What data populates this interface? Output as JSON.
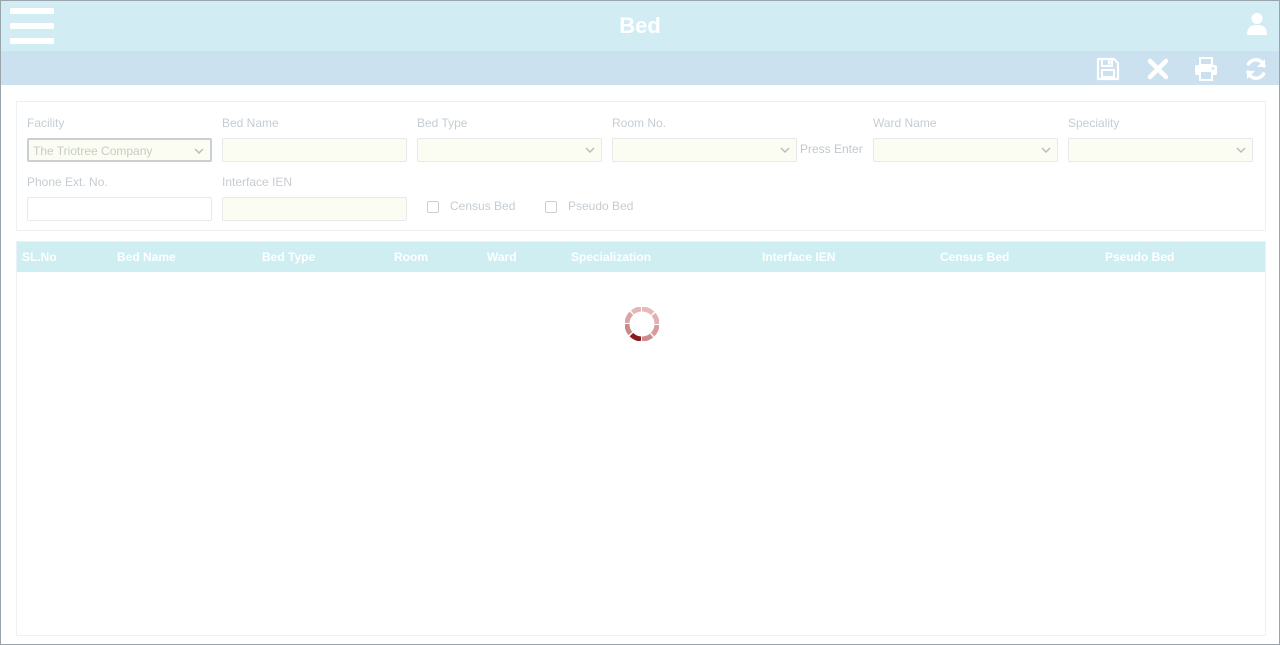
{
  "header": {
    "title": "Bed"
  },
  "icons": {
    "menu": "hamburger-menu-icon",
    "user": "user-icon",
    "save": "save-icon",
    "close": "close-icon",
    "print": "print-icon",
    "refresh": "refresh-icon",
    "dropdown": "chevron-down-icon",
    "loading": "loading-spinner-icon"
  },
  "colors": {
    "header_bg": "#d2ecf3",
    "toolbar_bg": "#cbe1ef",
    "grid_header_bg": "#cfeef1",
    "spinner_accent": "#8b1a1a"
  },
  "form": {
    "facility": {
      "label": "Facility",
      "value": "The Triotree Company"
    },
    "bed_name": {
      "label": "Bed Name",
      "value": ""
    },
    "bed_type": {
      "label": "Bed Type",
      "value": ""
    },
    "room_no": {
      "label": "Room No.",
      "value": "",
      "hint": "Press Enter"
    },
    "ward_name": {
      "label": "Ward Name",
      "value": ""
    },
    "speciality": {
      "label": "Speciality",
      "value": ""
    },
    "phone_ext": {
      "label": "Phone Ext. No.",
      "value": ""
    },
    "interface_ien": {
      "label": "Interface IEN",
      "value": ""
    },
    "census_bed": {
      "label": "Census Bed",
      "checked": false
    },
    "pseudo_bed": {
      "label": "Pseudo Bed",
      "checked": false
    }
  },
  "grid": {
    "columns": [
      "SL.No",
      "Bed Name",
      "Bed Type",
      "Room",
      "Ward",
      "Specialization",
      "Interface IEN",
      "Census Bed",
      "Pseudo Bed"
    ],
    "rows": []
  }
}
